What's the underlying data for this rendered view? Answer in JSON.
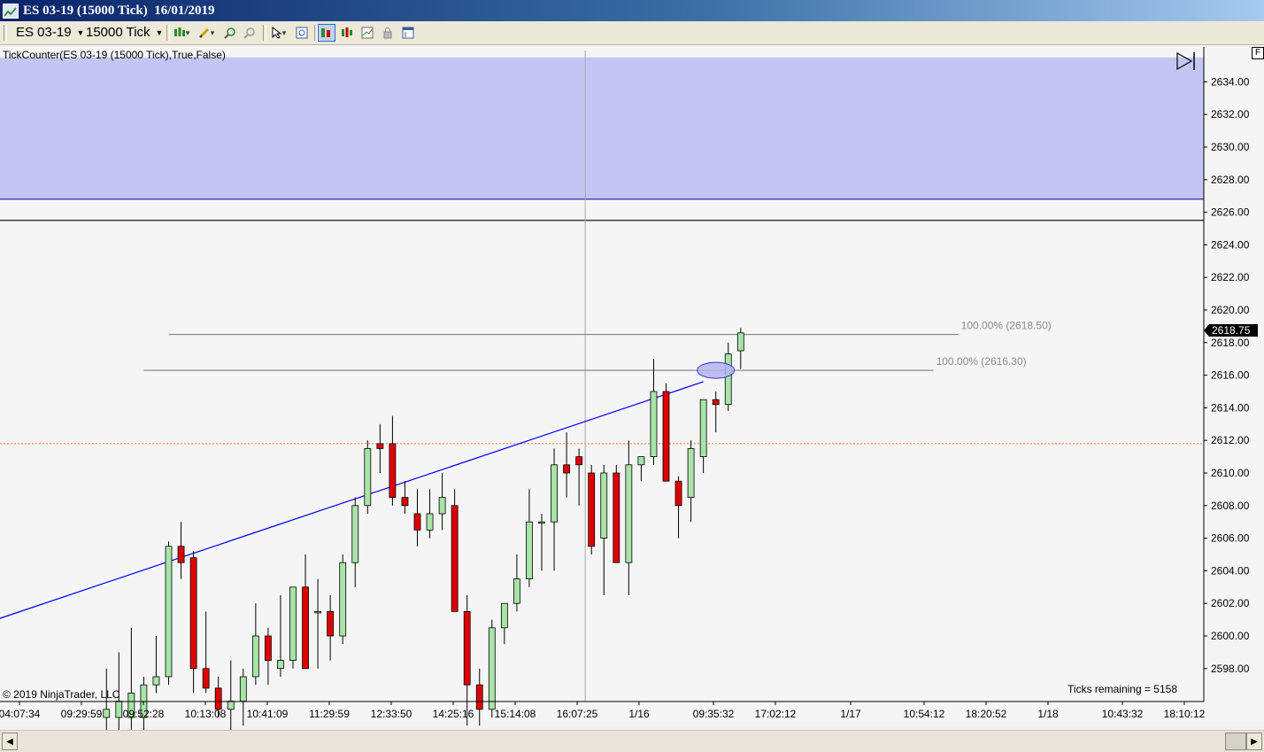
{
  "window": {
    "title": "ES 03-19 (15000 Tick)  16/01/2019"
  },
  "toolbar": {
    "instrument": "ES 03-19",
    "interval": "15000 Tick",
    "buttons": [
      {
        "name": "bar-type-icon",
        "dropdown": true
      },
      {
        "name": "draw-tool-pencil-icon",
        "dropdown": true
      },
      {
        "name": "zoom-in-icon"
      },
      {
        "name": "zoom-out-icon"
      },
      {
        "name": "pointer-icon",
        "dropdown": true
      },
      {
        "name": "data-box-icon"
      },
      {
        "name": "indicators-icon",
        "active": true
      },
      {
        "name": "strategies-icon"
      },
      {
        "name": "chart-trader-icon"
      },
      {
        "name": "lock-icon"
      },
      {
        "name": "properties-icon"
      }
    ]
  },
  "indicator_label": "TickCounter(ES  03-19 (15000  Tick),True,False)",
  "corner_box": "F",
  "copyright": "© 2019 NinjaTrader, LLC",
  "ticks_remaining": "Ticks remaining = 5158",
  "last_price_label": "2618.75",
  "colors": {
    "background": "#f5f5f5",
    "zone_fill": "#c5c5f5",
    "up_candle": "#a8e4a8",
    "down_candle": "#e00000",
    "trendline": "#0000ff",
    "dashed_line": "#ff4500",
    "level_line": "#707070",
    "marker_fill": "#b4b4f0"
  },
  "chart_data": {
    "type": "candlestick",
    "y_axis": {
      "min": 2596.5,
      "max": 2635.5,
      "tick_step": 2,
      "labels": [
        "2634.00",
        "2632.00",
        "2630.00",
        "2628.00",
        "2626.00",
        "2624.00",
        "2622.00",
        "2620.00",
        "2618.00",
        "2616.00",
        "2614.00",
        "2612.00",
        "2610.00",
        "2608.00",
        "2606.00",
        "2604.00",
        "2602.00",
        "2600.00",
        "2598.00"
      ]
    },
    "x_axis_labels": [
      "04:07:34",
      "09:29:59",
      "09:52:28",
      "10:13:08",
      "10:41:09",
      "11:29:59",
      "12:33:50",
      "14:25:16",
      "15:14:08",
      "16:07:25",
      "1/16",
      "09:35:32",
      "17:02:12",
      "1/17",
      "10:54:12",
      "18:20:52",
      "1/18",
      "10:43:32",
      "18:10:12"
    ],
    "candles": [
      {
        "o": 2595.0,
        "h": 2598.0,
        "l": 2594.0,
        "c": 2595.5
      },
      {
        "o": 2595.0,
        "h": 2599.0,
        "l": 2594.0,
        "c": 2596.0
      },
      {
        "o": 2595.0,
        "h": 2600.5,
        "l": 2593.0,
        "c": 2596.5
      },
      {
        "o": 2595.0,
        "h": 2597.5,
        "l": 2593.0,
        "c": 2597.0
      },
      {
        "o": 2597.0,
        "h": 2600.0,
        "l": 2596.5,
        "c": 2597.5
      },
      {
        "o": 2597.5,
        "h": 2605.8,
        "l": 2597.0,
        "c": 2605.5
      },
      {
        "o": 2605.5,
        "h": 2607.0,
        "l": 2603.5,
        "c": 2604.5
      },
      {
        "o": 2604.8,
        "h": 2605.2,
        "l": 2596.5,
        "c": 2598.0
      },
      {
        "o": 2598.0,
        "h": 2601.5,
        "l": 2596.5,
        "c": 2596.8
      },
      {
        "o": 2596.8,
        "h": 2597.5,
        "l": 2595.0,
        "c": 2595.5
      },
      {
        "o": 2595.5,
        "h": 2598.5,
        "l": 2594.0,
        "c": 2596.0
      },
      {
        "o": 2596.0,
        "h": 2598.0,
        "l": 2594.5,
        "c": 2597.5
      },
      {
        "o": 2597.5,
        "h": 2602.0,
        "l": 2597.0,
        "c": 2600.0
      },
      {
        "o": 2600.0,
        "h": 2600.5,
        "l": 2597.0,
        "c": 2598.5
      },
      {
        "o": 2598.0,
        "h": 2602.5,
        "l": 2597.5,
        "c": 2598.5
      },
      {
        "o": 2598.5,
        "h": 2603.0,
        "l": 2598.0,
        "c": 2603.0
      },
      {
        "o": 2603.0,
        "h": 2605.0,
        "l": 2598.0,
        "c": 2598.0
      },
      {
        "o": 2601.5,
        "h": 2603.5,
        "l": 2598.0,
        "c": 2601.5
      },
      {
        "o": 2601.5,
        "h": 2602.5,
        "l": 2598.5,
        "c": 2600.0
      },
      {
        "o": 2600.0,
        "h": 2605.0,
        "l": 2599.5,
        "c": 2604.5
      },
      {
        "o": 2604.5,
        "h": 2608.5,
        "l": 2603.0,
        "c": 2608.0
      },
      {
        "o": 2608.0,
        "h": 2612.0,
        "l": 2607.5,
        "c": 2611.5
      },
      {
        "o": 2611.8,
        "h": 2613.0,
        "l": 2610.0,
        "c": 2611.5
      },
      {
        "o": 2611.8,
        "h": 2613.5,
        "l": 2608.0,
        "c": 2608.5
      },
      {
        "o": 2608.5,
        "h": 2609.5,
        "l": 2607.5,
        "c": 2608.0
      },
      {
        "o": 2607.5,
        "h": 2609.0,
        "l": 2605.5,
        "c": 2606.5
      },
      {
        "o": 2606.5,
        "h": 2609.0,
        "l": 2606.0,
        "c": 2607.5
      },
      {
        "o": 2607.5,
        "h": 2610.0,
        "l": 2606.5,
        "c": 2608.5
      },
      {
        "o": 2608.0,
        "h": 2609.0,
        "l": 2601.5,
        "c": 2601.5
      },
      {
        "o": 2601.5,
        "h": 2602.5,
        "l": 2594.5,
        "c": 2597.0
      },
      {
        "o": 2597.0,
        "h": 2598.0,
        "l": 2594.5,
        "c": 2595.5
      },
      {
        "o": 2595.5,
        "h": 2601.0,
        "l": 2595.0,
        "c": 2600.5
      },
      {
        "o": 2600.5,
        "h": 2602.0,
        "l": 2599.5,
        "c": 2602.0
      },
      {
        "o": 2602.0,
        "h": 2605.0,
        "l": 2601.5,
        "c": 2603.5
      },
      {
        "o": 2603.5,
        "h": 2609.0,
        "l": 2603.0,
        "c": 2607.0
      },
      {
        "o": 2607.0,
        "h": 2607.5,
        "l": 2604.0,
        "c": 2607.0
      },
      {
        "o": 2607.0,
        "h": 2611.5,
        "l": 2604.0,
        "c": 2610.5
      },
      {
        "o": 2610.5,
        "h": 2612.5,
        "l": 2608.5,
        "c": 2610.0
      },
      {
        "o": 2611.0,
        "h": 2611.5,
        "l": 2608.0,
        "c": 2610.5
      },
      {
        "o": 2610.0,
        "h": 2610.5,
        "l": 2605.0,
        "c": 2605.5
      },
      {
        "o": 2606.0,
        "h": 2610.5,
        "l": 2602.5,
        "c": 2610.0
      },
      {
        "o": 2610.0,
        "h": 2610.5,
        "l": 2605.5,
        "c": 2604.5
      },
      {
        "o": 2604.5,
        "h": 2612.0,
        "l": 2602.5,
        "c": 2610.5
      },
      {
        "o": 2610.5,
        "h": 2611.0,
        "l": 2609.5,
        "c": 2611.0
      },
      {
        "o": 2611.0,
        "h": 2617.0,
        "l": 2610.5,
        "c": 2615.0
      },
      {
        "o": 2615.0,
        "h": 2615.5,
        "l": 2609.5,
        "c": 2609.5
      },
      {
        "o": 2609.5,
        "h": 2609.8,
        "l": 2606.0,
        "c": 2608.0
      },
      {
        "o": 2608.5,
        "h": 2612.0,
        "l": 2607.0,
        "c": 2611.5
      },
      {
        "o": 2611.0,
        "h": 2614.5,
        "l": 2610.0,
        "c": 2614.5
      },
      {
        "o": 2614.5,
        "h": 2615.0,
        "l": 2612.5,
        "c": 2614.2
      },
      {
        "o": 2614.2,
        "h": 2618.0,
        "l": 2613.8,
        "c": 2617.3
      },
      {
        "o": 2617.5,
        "h": 2618.9,
        "l": 2616.4,
        "c": 2618.6
      }
    ],
    "trendline": {
      "from": {
        "bar": -12.0,
        "price": 2600.2
      },
      "to": {
        "bar": 48.0,
        "price": 2615.6
      }
    },
    "fib_levels": [
      {
        "label": "100.00% (2618.50)",
        "price": 2618.5,
        "from_bar": 5.0,
        "to_bar": 68.5
      },
      {
        "label": "100.00% (2616.30)",
        "price": 2616.3,
        "from_bar": 3.0,
        "to_bar": 66.5
      }
    ],
    "zone": {
      "top_price": 2635.5,
      "bottom_price": 2626.8
    },
    "horizontal_line": {
      "price": 2625.5
    },
    "dashed_line": {
      "price": 2611.8
    },
    "crosshair_bar": 38.5,
    "marker": {
      "bar": 49.0,
      "price": 2616.3
    }
  }
}
